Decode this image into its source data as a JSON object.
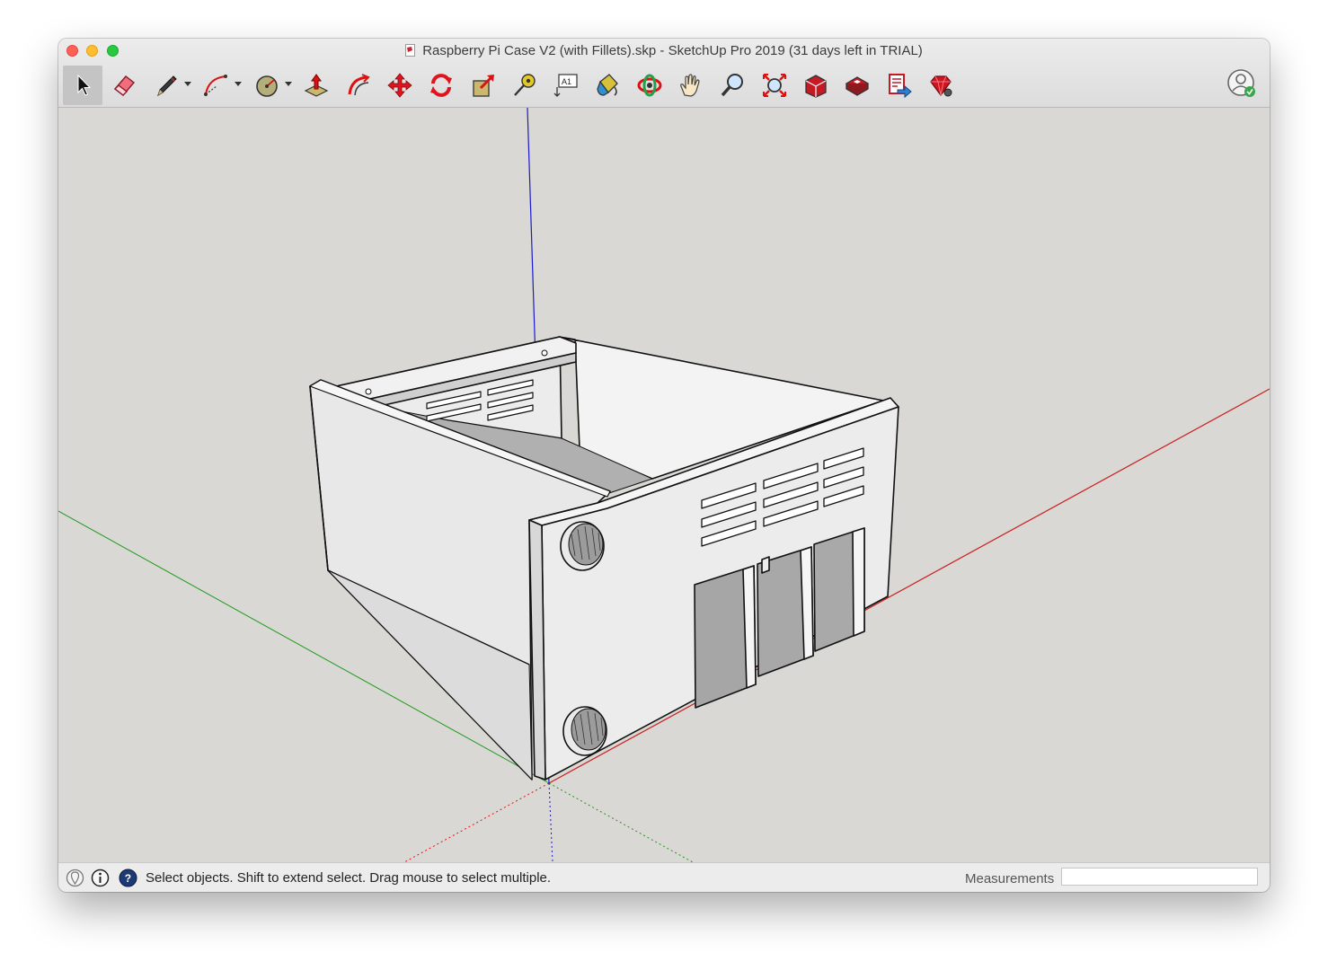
{
  "window": {
    "title": "Raspberry Pi Case V2 (with Fillets).skp - SketchUp Pro 2019 (31 days left in TRIAL)"
  },
  "toolbar": {
    "tools": [
      {
        "name": "select-tool",
        "icon": "arrow-cursor-icon",
        "active": true
      },
      {
        "name": "eraser-tool",
        "icon": "eraser-icon"
      },
      {
        "name": "line-tool",
        "icon": "pencil-icon",
        "has_dropdown": true
      },
      {
        "name": "arc-tool",
        "icon": "arc-icon",
        "has_dropdown": true
      },
      {
        "name": "shapes-tool",
        "icon": "circle-shape-icon",
        "has_dropdown": true
      },
      {
        "name": "push-pull-tool",
        "icon": "push-pull-icon"
      },
      {
        "name": "offset-tool",
        "icon": "offset-icon"
      },
      {
        "name": "move-tool",
        "icon": "move-arrows-icon"
      },
      {
        "name": "rotate-tool",
        "icon": "rotate-icon"
      },
      {
        "name": "scale-tool",
        "icon": "scale-icon"
      },
      {
        "name": "tape-measure-tool",
        "icon": "tape-measure-icon"
      },
      {
        "name": "text-tool",
        "icon": "text-icon",
        "label": "A1"
      },
      {
        "name": "paint-bucket-tool",
        "icon": "paint-bucket-icon"
      },
      {
        "name": "orbit-tool",
        "icon": "orbit-icon"
      },
      {
        "name": "pan-tool",
        "icon": "hand-icon"
      },
      {
        "name": "zoom-tool",
        "icon": "magnifier-icon"
      },
      {
        "name": "zoom-extents-tool",
        "icon": "zoom-extents-icon"
      },
      {
        "name": "3d-warehouse-tool",
        "icon": "warehouse-icon"
      },
      {
        "name": "extension-warehouse-tool",
        "icon": "extension-warehouse-icon"
      },
      {
        "name": "send-to-layout-tool",
        "icon": "layout-send-icon"
      },
      {
        "name": "ruby-console-tool",
        "icon": "ruby-gem-icon"
      }
    ],
    "account_icon": "user-account-icon"
  },
  "status": {
    "message": "Select objects. Shift to extend select. Drag mouse to select multiple.",
    "icons": [
      "geo-location-icon",
      "credits-info-icon",
      "help-icon"
    ]
  },
  "measurements": {
    "label": "Measurements",
    "value": ""
  },
  "colors": {
    "viewport_bg": "#d9d8d4",
    "red_axis": "#cc1d1d",
    "green_axis": "#1a9a1a",
    "blue_axis": "#1a1acc",
    "model_face": "#ebebeb"
  }
}
